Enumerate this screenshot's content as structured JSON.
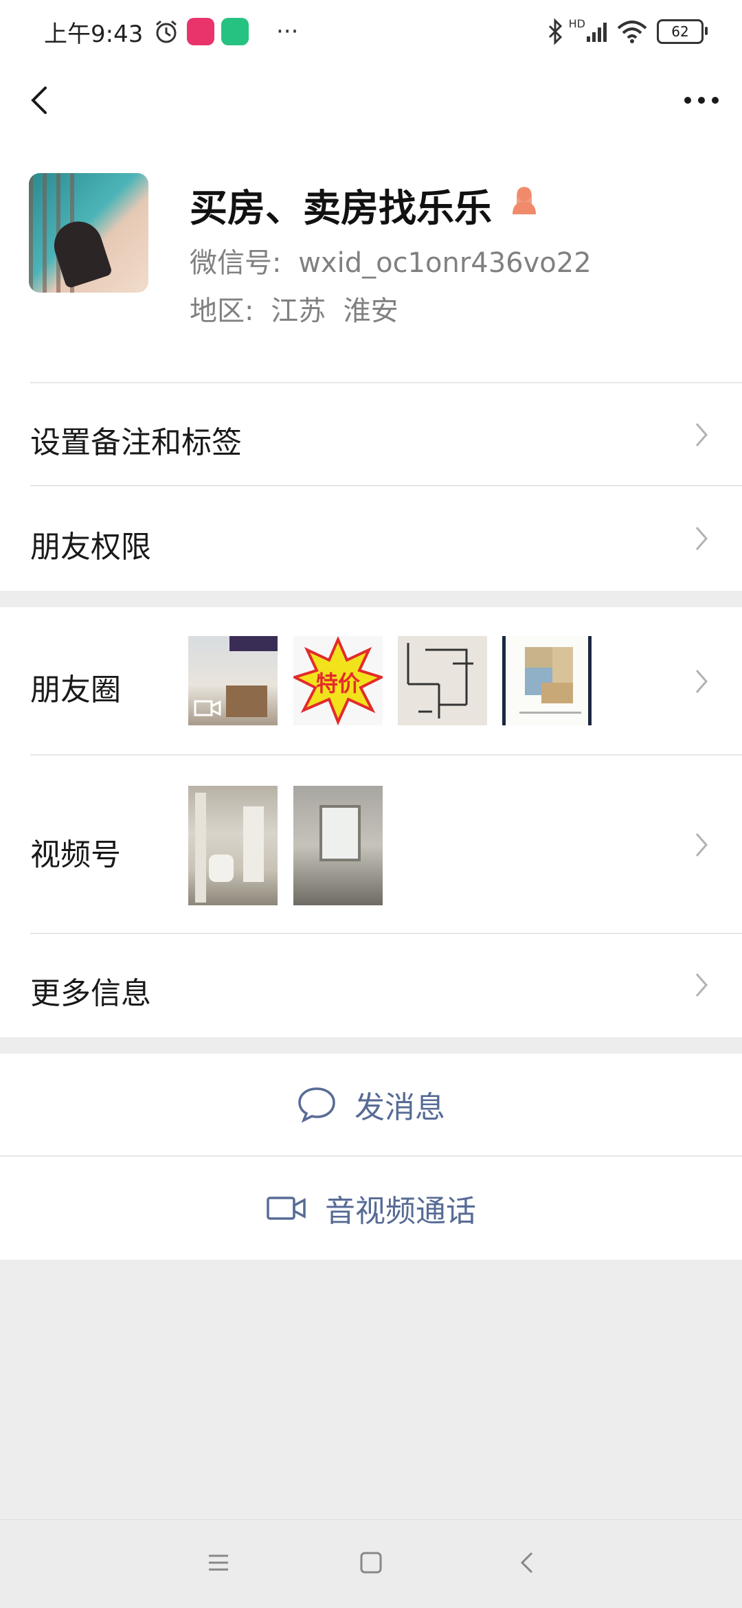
{
  "status_bar": {
    "time": "上午9:43",
    "more": "···",
    "network": "HD",
    "battery": "62"
  },
  "top_nav": {
    "back_icon": "chevron-left-icon",
    "more_icon": "more-dots-icon"
  },
  "profile": {
    "name": "买房、卖房找乐乐",
    "gender_icon": "female-icon",
    "wechat_id_label": "微信号:",
    "wechat_id": "wxid_oc1onr436vo22",
    "region_label": "地区:",
    "region": "江苏  淮安"
  },
  "menu": {
    "remark_tags": "设置备注和标签",
    "friend_permissions": "朋友权限",
    "moments": "朋友圈",
    "channels": "视频号",
    "more_info": "更多信息"
  },
  "moments_thumbs": {
    "special_price": "特价"
  },
  "actions": {
    "send_message": "发消息",
    "video_call": "音视频通话"
  },
  "colors": {
    "link_blue": "#576b95",
    "background": "#ededed",
    "female_accent": "#f08a6a"
  }
}
